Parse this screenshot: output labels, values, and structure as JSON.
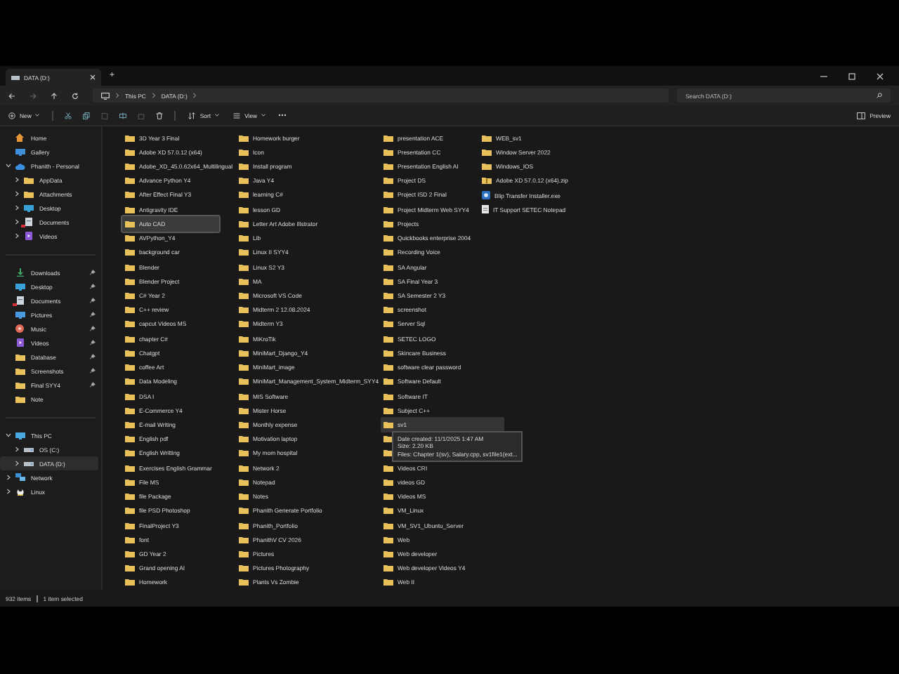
{
  "window": {
    "tab_title": "DATA (D:)",
    "new_tab": "+"
  },
  "address": {
    "crumbs": [
      "This PC",
      "DATA (D:)"
    ],
    "search_placeholder": "Search DATA (D:)"
  },
  "toolbar": {
    "new": "New",
    "sort": "Sort",
    "view": "View",
    "preview": "Preview"
  },
  "sidebar": {
    "sections": [
      [
        {
          "label": "Home",
          "kind": "home"
        },
        {
          "label": "Gallery",
          "kind": "gallery"
        },
        {
          "label": "Phanith - Personal",
          "kind": "cloud",
          "expanded": true,
          "children": [
            {
              "label": "AppData",
              "kind": "folder",
              "expanded": false
            },
            {
              "label": "Attachments",
              "kind": "folder",
              "expanded": false
            },
            {
              "label": "Desktop",
              "kind": "desktop",
              "expanded": false
            },
            {
              "label": "Documents",
              "kind": "documents",
              "expanded": false,
              "sync_error": true
            },
            {
              "label": "Videos",
              "kind": "videos",
              "expanded": false
            }
          ]
        }
      ],
      [
        {
          "label": "Downloads",
          "kind": "downloads",
          "pinned": true
        },
        {
          "label": "Desktop",
          "kind": "desktop",
          "pinned": true
        },
        {
          "label": "Documents",
          "kind": "documents",
          "pinned": true,
          "sync_error": true
        },
        {
          "label": "Pictures",
          "kind": "pictures",
          "pinned": true
        },
        {
          "label": "Music",
          "kind": "music",
          "pinned": true
        },
        {
          "label": "Videos",
          "kind": "videos",
          "pinned": true
        },
        {
          "label": "Database",
          "kind": "folder",
          "pinned": true
        },
        {
          "label": "Screenshots",
          "kind": "folder",
          "pinned": true
        },
        {
          "label": "Final SYY4",
          "kind": "folder",
          "pinned": true
        },
        {
          "label": "Note",
          "kind": "folder",
          "pinned": false
        }
      ],
      [
        {
          "label": "This PC",
          "kind": "pc",
          "expanded": true,
          "children": [
            {
              "label": "OS (C:)",
              "kind": "drive",
              "expanded": false,
              "selected": false
            },
            {
              "label": "DATA (D:)",
              "kind": "drive",
              "expanded": false,
              "selected": true
            }
          ]
        },
        {
          "label": "Network",
          "kind": "network",
          "expanded": false
        },
        {
          "label": "Linux",
          "kind": "linux",
          "expanded": false
        }
      ]
    ]
  },
  "columns": [
    [
      {
        "name": "3D Year 3 Final",
        "selected": false
      },
      {
        "name": "Adobe XD 57.0.12 (x64)",
        "selected": false
      },
      {
        "name": "Adobe_XD_45.0.62x64_Multilingual",
        "selected": false
      },
      {
        "name": "Advance Python Y4",
        "selected": false
      },
      {
        "name": "After Effect Final Y3",
        "selected": false
      },
      {
        "name": "Antigravity IDE",
        "selected": false
      },
      {
        "name": "Auto CAD",
        "selected": true
      },
      {
        "name": "AVPython_Y4",
        "selected": false
      },
      {
        "name": "background car",
        "selected": false
      },
      {
        "name": "Blender",
        "selected": false
      },
      {
        "name": "Blender Project",
        "selected": false
      },
      {
        "name": "C# Year 2",
        "selected": false
      },
      {
        "name": "C++ review",
        "selected": false
      },
      {
        "name": "capcut Videos MS",
        "selected": false
      },
      {
        "name": "chapter C#",
        "selected": false
      },
      {
        "name": "Chatgpt",
        "selected": false
      },
      {
        "name": "coffee Art",
        "selected": false
      },
      {
        "name": "Data Modeling",
        "selected": false
      },
      {
        "name": "DSA I",
        "selected": false
      },
      {
        "name": "E-Commerce Y4",
        "selected": false
      },
      {
        "name": "E-mail Writing",
        "selected": false
      },
      {
        "name": "English pdf",
        "selected": false
      },
      {
        "name": "English Writting",
        "selected": false
      },
      {
        "name": "Exercises English Grammar",
        "selected": false
      },
      {
        "name": "File MS",
        "selected": false
      },
      {
        "name": "file Package",
        "selected": false
      },
      {
        "name": "file PSD Photoshop",
        "selected": false
      },
      {
        "name": "FinalProject Y3",
        "selected": false
      },
      {
        "name": "font",
        "selected": false
      },
      {
        "name": "GD Year 2",
        "selected": false
      },
      {
        "name": "Grand opening AI",
        "selected": false
      },
      {
        "name": "Homework",
        "selected": false
      }
    ],
    [
      {
        "name": "Homework burger",
        "selected": false
      },
      {
        "name": "Icon",
        "selected": false
      },
      {
        "name": "Install program",
        "selected": false
      },
      {
        "name": "Java Y4",
        "selected": false
      },
      {
        "name": "learning C#",
        "selected": false
      },
      {
        "name": "lesson GD",
        "selected": false
      },
      {
        "name": "Letter Art Adobe Illstrator",
        "selected": false
      },
      {
        "name": "Lib",
        "selected": false
      },
      {
        "name": "Linux II SYY4",
        "selected": false
      },
      {
        "name": "Linux S2 Y3",
        "selected": false
      },
      {
        "name": "MA",
        "selected": false
      },
      {
        "name": "Microsoft VS Code",
        "selected": false
      },
      {
        "name": "Midterm 2 12.08.2024",
        "selected": false
      },
      {
        "name": "Midterm Y3",
        "selected": false
      },
      {
        "name": "MiKroTik",
        "selected": false
      },
      {
        "name": "MiniMart_Django_Y4",
        "selected": false
      },
      {
        "name": "MiniMart_image",
        "selected": false
      },
      {
        "name": "MiniMart_Management_System_Midterm_SYY4",
        "selected": false
      },
      {
        "name": "MIS Software",
        "selected": false
      },
      {
        "name": "Mister Horse",
        "selected": false
      },
      {
        "name": "Monthly expense",
        "selected": false
      },
      {
        "name": "Motivation laptop",
        "selected": false
      },
      {
        "name": "My mom hospital",
        "selected": false
      },
      {
        "name": "Network 2",
        "selected": false
      },
      {
        "name": "Notepad",
        "selected": false
      },
      {
        "name": "Notes",
        "selected": false
      },
      {
        "name": "Phanith Generate Portfolio",
        "selected": false
      },
      {
        "name": "Phanith_Portfolio",
        "selected": false
      },
      {
        "name": "PhanithV CV 2026",
        "selected": false
      },
      {
        "name": "Pictures",
        "selected": false
      },
      {
        "name": "Pictures Photography",
        "selected": false
      },
      {
        "name": "Plants Vs Zombie",
        "selected": false
      }
    ],
    [
      {
        "name": "presentation ACE",
        "selected": false
      },
      {
        "name": "Presentation CC",
        "selected": false
      },
      {
        "name": "Presentation English AI",
        "selected": false
      },
      {
        "name": "Project DS",
        "selected": false
      },
      {
        "name": "Project ISD 2 Final",
        "selected": false
      },
      {
        "name": "Project Midterm Web SYY4",
        "selected": false
      },
      {
        "name": "Projects",
        "selected": false
      },
      {
        "name": "Quickbooks enterprise 2004",
        "selected": false
      },
      {
        "name": "Recording Voice",
        "selected": false
      },
      {
        "name": "SA Angular",
        "selected": false
      },
      {
        "name": "SA Final Year 3",
        "selected": false
      },
      {
        "name": "SA Semester 2 Y3",
        "selected": false
      },
      {
        "name": "screenshot",
        "selected": false
      },
      {
        "name": "Server Sql",
        "selected": false
      },
      {
        "name": "SETEC LOGO",
        "selected": false
      },
      {
        "name": "Skincare Business",
        "selected": false
      },
      {
        "name": "software clear password",
        "selected": false
      },
      {
        "name": "Software Default",
        "selected": false
      },
      {
        "name": "Software IT",
        "selected": false
      },
      {
        "name": "Subject C++",
        "selected": false
      },
      {
        "name": "sv1",
        "selected": false,
        "hovered": true,
        "tooltip": [
          "Date created: 11/1/2025 1:47 AM",
          "Size: 2.20 KB",
          "Files: Chapter 1(sv), Salary.cpp, sv1file1(ext..."
        ]
      },
      {
        "kind": "folder"
      },
      {
        "kind": "folder"
      },
      {
        "name": "Videos CRI",
        "selected": false
      },
      {
        "name": "videos GD",
        "selected": false
      },
      {
        "name": "Videos MS",
        "selected": false
      },
      {
        "name": "VM_Linux",
        "selected": false
      },
      {
        "name": "VM_SV1_Ubuntu_Server",
        "selected": false
      },
      {
        "name": "Web",
        "selected": false
      },
      {
        "name": "Web developer",
        "selected": false
      },
      {
        "name": "Web developer Videos Y4",
        "selected": false
      },
      {
        "name": "Web II",
        "selected": false
      }
    ],
    [
      {
        "name": "WEB_sv1",
        "kind": "folder",
        "selected": false
      },
      {
        "name": "Window Server 2022",
        "kind": "folder",
        "selected": false
      },
      {
        "name": "Windows_IOS",
        "kind": "folder",
        "selected": false
      },
      {
        "name": "Adobe XD 57.0.12 (x64).zip",
        "kind": "zip",
        "selected": false
      },
      {
        "name": "Blip Transfer Installer.exe",
        "kind": "app",
        "selected": false
      },
      {
        "name": "IT Support SETEC Notepad",
        "kind": "text",
        "selected": false
      }
    ]
  ],
  "status_bar": {
    "count": "932 items",
    "selection": "1 item selected"
  }
}
